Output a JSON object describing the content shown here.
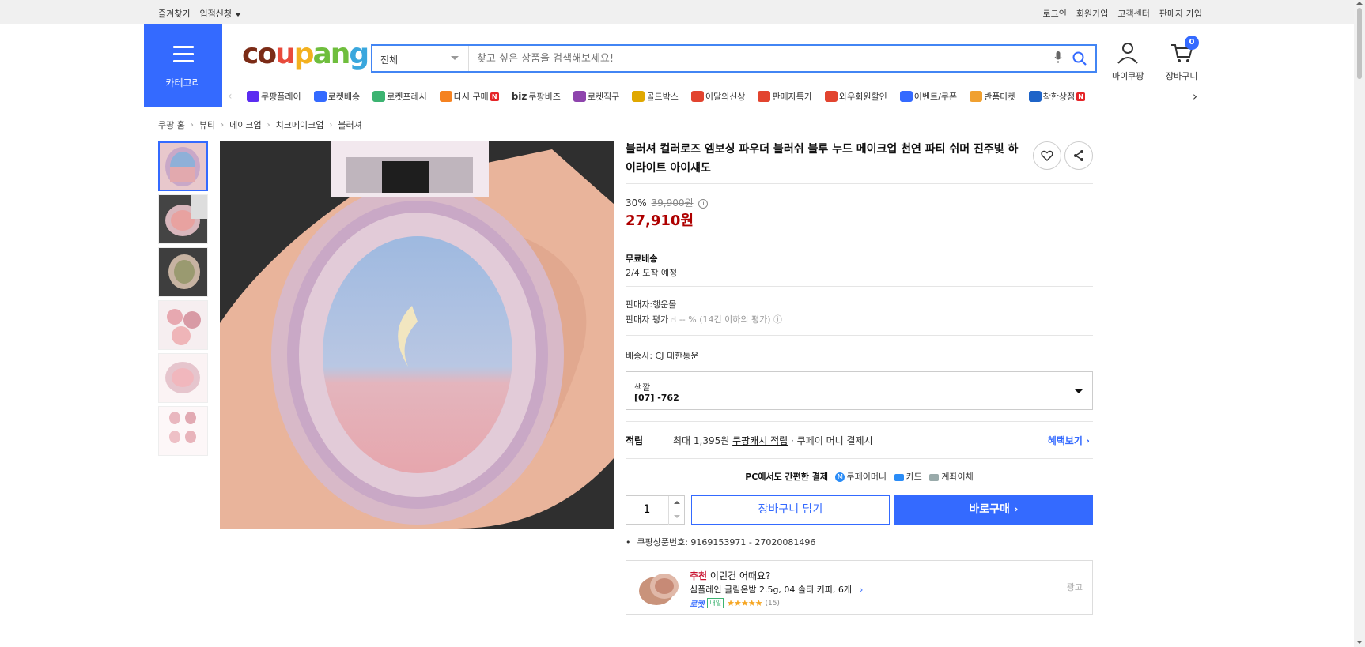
{
  "topbar": {
    "left": [
      "즐겨찾기",
      "입점신청"
    ],
    "right": [
      "로그인",
      "회원가입",
      "고객센터",
      "판매자 가입"
    ]
  },
  "category": {
    "label": "카테고리"
  },
  "logo": {
    "text": [
      "co",
      "u",
      "p",
      "an",
      "g"
    ]
  },
  "search": {
    "category_selected": "전체",
    "placeholder": "찾고 싶은 상품을 검색해보세요!"
  },
  "header": {
    "mypage_label": "마이쿠팡",
    "cart_label": "장바구니",
    "cart_count": "0"
  },
  "gnb": [
    {
      "label": "쿠팡플레이",
      "icon": "play-icon",
      "color": "#5b2cf1",
      "new": false
    },
    {
      "label": "로켓배송",
      "icon": "rocket-icon",
      "color": "#346aff",
      "new": false
    },
    {
      "label": "로켓프레시",
      "icon": "rocket-fresh-icon",
      "color": "#3cb371",
      "new": false
    },
    {
      "label": "다시 구매",
      "icon": "repurchase-icon",
      "color": "#f58220",
      "new": true
    },
    {
      "label": "쿠팡비즈",
      "icon": "biz-icon",
      "color": "#333333",
      "new": false,
      "prefix": "biz"
    },
    {
      "label": "로켓직구",
      "icon": "global-icon",
      "color": "#8e44ad",
      "new": false
    },
    {
      "label": "골드박스",
      "icon": "goldbox-icon",
      "color": "#e0a800",
      "new": false
    },
    {
      "label": "이달의신상",
      "icon": "bag-icon",
      "color": "#e2442f",
      "new": false
    },
    {
      "label": "판매자특가",
      "icon": "percent-icon",
      "color": "#e2442f",
      "new": false
    },
    {
      "label": "와우회원할인",
      "icon": "wow-icon",
      "color": "#e2442f",
      "new": false
    },
    {
      "label": "이벤트/쿠폰",
      "icon": "coupon-icon",
      "color": "#346aff",
      "new": false
    },
    {
      "label": "반품마켓",
      "icon": "return-market-icon",
      "color": "#f0a030",
      "new": false
    },
    {
      "label": "착한상점",
      "icon": "shop-icon",
      "color": "#1e64c8",
      "new": true
    }
  ],
  "breadcrumb": [
    "쿠팡 홈",
    "뷰티",
    "메이크업",
    "치크메이크업",
    "블러셔"
  ],
  "product": {
    "title": "블러셔 컬러로즈 엠보싱 파우더 블러쉬 블루 누드 메이크업 천연 파티 쉬머 진주빛 하이라이트 아이섀도",
    "discount_rate": "30%",
    "original_price": "39,900원",
    "price": "27,910원",
    "shipping_title": "무료배송",
    "shipping_eta": "2/4 도착 예정",
    "seller": "판매자:행운몰",
    "seller_rating_label": "판매자 평가",
    "seller_rating_value": "-- % (14건 이하의 평가)",
    "carrier": "배송사:  CJ 대한통운",
    "option_label": "색깔",
    "option_value": "[07] -762",
    "reward_title": "적립",
    "reward_text_prefix": "최대 1,395원",
    "reward_link": "쿠팡캐시 적립",
    "reward_suffix": "· 쿠페이 머니 결제시",
    "reward_more": "혜택보기 ›",
    "pay_title": "PC에서도 간편한 결제",
    "pay_methods": [
      "쿠페이머니",
      "카드",
      "계좌이체"
    ],
    "quantity": "1",
    "add_cart": "장바구니 담기",
    "buy_now": "바로구매 ›",
    "product_id": "쿠팡상품번호: 9169153971 - 27020081496"
  },
  "recommend": {
    "prefix": "추천",
    "title": " 이런건 어때요?",
    "item": "심플레인 글림온밤 2.5g, 04 솔티 커피, 6개",
    "rocket": "로켓",
    "badge": "내일",
    "stars": "★★★★★",
    "count": "(15)",
    "ad": "광고"
  },
  "thumbnails": [
    "thumb-1",
    "thumb-2",
    "thumb-3",
    "thumb-4",
    "thumb-5",
    "thumb-6"
  ]
}
